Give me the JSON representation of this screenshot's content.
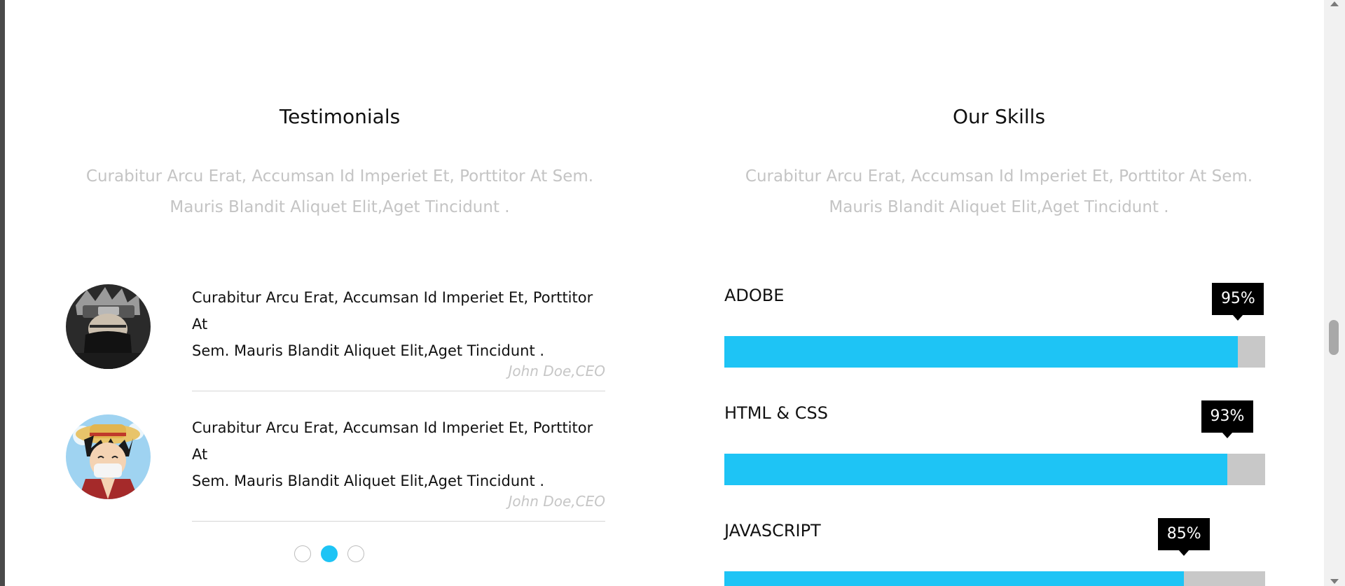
{
  "colors": {
    "accent": "#1ec4f5",
    "track": "#c8c8c8",
    "tooltip": "#000000"
  },
  "testimonials_section": {
    "title": "Testimonials",
    "subtitle_line1": "Curabitur Arcu Erat, Accumsan Id Imperiet Et, Porttitor At Sem.",
    "subtitle_line2": "Mauris Blandit Aliquet Elit,Aget Tincidunt .",
    "items": [
      {
        "avatar_icon": "ninja-avatar",
        "quote_line1": "Curabitur Arcu Erat, Accumsan Id Imperiet Et, Porttitor At",
        "quote_line2": "Sem. Mauris Blandit Aliquet Elit,Aget Tincidunt .",
        "author": "John Doe,CEO"
      },
      {
        "avatar_icon": "straw-hat-avatar",
        "quote_line1": "Curabitur Arcu Erat, Accumsan Id Imperiet Et, Porttitor At",
        "quote_line2": "Sem. Mauris Blandit Aliquet Elit,Aget Tincidunt .",
        "author": "John Doe,CEO"
      }
    ],
    "pagination": {
      "count": 3,
      "active_index": 1
    }
  },
  "skills_section": {
    "title": "Our Skills",
    "subtitle_line1": "Curabitur Arcu Erat, Accumsan Id Imperiet Et, Porttitor At Sem.",
    "subtitle_line2": "Mauris Blandit Aliquet Elit,Aget Tincidunt .",
    "skills": [
      {
        "name": "ADOBE",
        "label": "95%",
        "percent": 95
      },
      {
        "name": "HTML & CSS",
        "label": "93%",
        "percent": 93
      },
      {
        "name": "JAVASCRIPT",
        "label": "85%",
        "percent": 85
      }
    ]
  }
}
